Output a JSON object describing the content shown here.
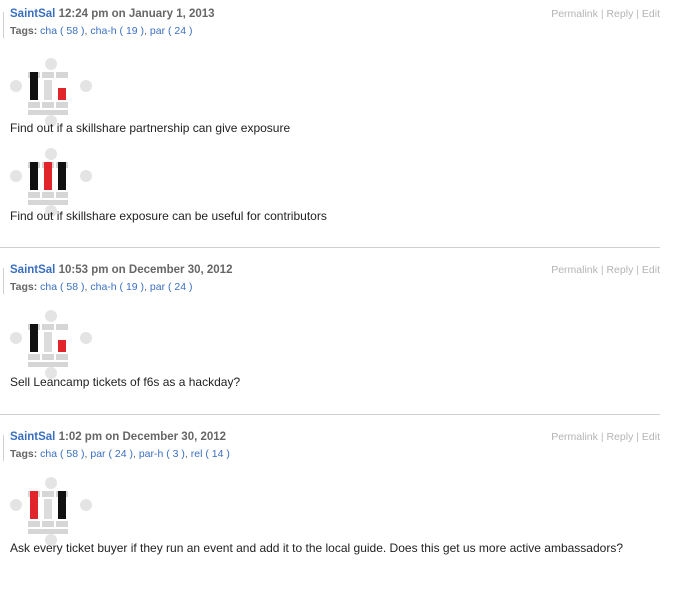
{
  "posts": [
    {
      "author": "SaintSal",
      "datetime": "12:24 pm on January 1, 2013",
      "tags_label": "Tags:",
      "tags": [
        "cha ( 58 )",
        "cha-h ( 19 )",
        "par ( 24 )"
      ],
      "actions": {
        "permalink": "Permalink",
        "reply": "Reply",
        "edit": "Edit"
      },
      "ideas": [
        {
          "text": "Find out if a skillshare partnership can give exposure",
          "bars": [
            "black",
            "gray",
            "red"
          ]
        },
        {
          "text": "Find out if skillshare exposure can be useful for contributors",
          "bars": [
            "black",
            "red",
            "black"
          ]
        }
      ]
    },
    {
      "author": "SaintSal",
      "datetime": "10:53 pm on December 30, 2012",
      "tags_label": "Tags:",
      "tags": [
        "cha ( 58 )",
        "cha-h ( 19 )",
        "par ( 24 )"
      ],
      "actions": {
        "permalink": "Permalink",
        "reply": "Reply",
        "edit": "Edit"
      },
      "ideas": [
        {
          "text": "Sell Leancamp tickets of f6s as a hackday?",
          "bars": [
            "black",
            "gray",
            "red"
          ]
        }
      ]
    },
    {
      "author": "SaintSal",
      "datetime": "1:02 pm on December 30, 2012",
      "tags_label": "Tags:",
      "tags": [
        "cha ( 58 )",
        "par ( 24 )",
        "par-h ( 3 )",
        "rel ( 14 )"
      ],
      "actions": {
        "permalink": "Permalink",
        "reply": "Reply",
        "edit": "Edit"
      },
      "ideas": [
        {
          "text": "Ask every ticket buyer if they run an event and add it to the local guide. Does this get us more active ambassadors?",
          "bars": [
            "red",
            "gray",
            "black"
          ]
        }
      ]
    }
  ],
  "colors": {
    "link": "#3a6fc0",
    "red": "#e0262b",
    "black": "#111111",
    "gray": "#dcdcdc",
    "divider": "#cfcfcf"
  }
}
